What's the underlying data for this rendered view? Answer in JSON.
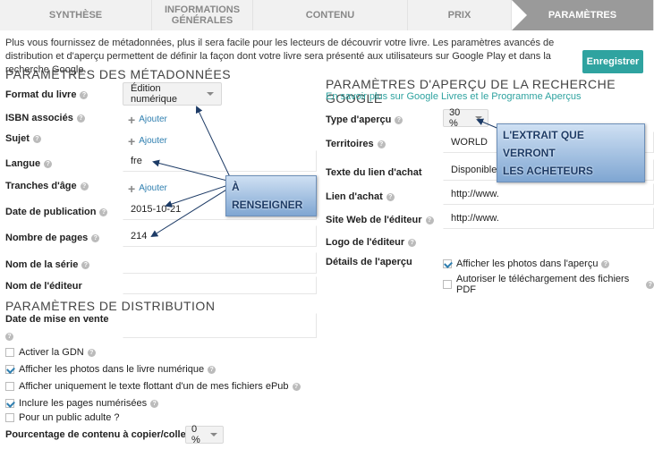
{
  "tabs": [
    "SYNTHÈSE",
    "INFORMATIONS GÉNÉRALES",
    "CONTENU",
    "PRIX",
    "PARAMÈTRES"
  ],
  "intro": "Plus vous fournissez de métadonnées, plus il sera facile pour les lecteurs de découvrir votre livre. Les paramètres avancés de distribution et d'aperçu permettent de définir la façon dont votre livre sera présenté aux utilisateurs sur Google Play et dans la recherche Google.",
  "save_label": "Enregistrer",
  "metadata": {
    "title": "PARAMÈTRES DES MÉTADONNÉES",
    "format_label": "Format du livre",
    "format_value": "Édition numérique",
    "isbn_label": "ISBN associés",
    "subject_label": "Sujet",
    "language_label": "Langue",
    "language_value": "fre",
    "age_label": "Tranches d'âge",
    "pubdate_label": "Date de publication",
    "pubdate_value": "2015-10-21",
    "pages_label": "Nombre de pages",
    "pages_value": "214",
    "series_label": "Nom de la série",
    "publisher_label": "Nom de l'éditeur",
    "add_label": "Ajouter"
  },
  "distribution": {
    "title": "PARAMÈTRES DE DISTRIBUTION",
    "sale_date_label": "Date de mise en vente",
    "options": [
      {
        "label": "Activer la GDN",
        "checked": false
      },
      {
        "label": "Afficher les photos dans le livre numérique",
        "checked": true
      },
      {
        "label": "Afficher uniquement le texte flottant d'un de mes fichiers ePub",
        "checked": false
      },
      {
        "label": "Inclure les pages numérisées",
        "checked": true
      },
      {
        "label": "Pour un public adulte ?",
        "checked": false
      }
    ],
    "copy_label": "Pourcentage de contenu à copier/coller",
    "copy_value": "0 %"
  },
  "preview": {
    "title": "PARAMÈTRES D'APERÇU DE LA RECHERCHE GOOGLE",
    "link": "En savoir plus sur Google Livres et le Programme Aperçus",
    "type_label": "Type d'aperçu",
    "type_value": "30 %",
    "territories_label": "Territoires",
    "territories_value": "WORLD",
    "buy_text_label": "Texte du lien d'achat",
    "buy_text_value": "Disponible chez",
    "buy_link_label": "Lien d'achat",
    "buy_link_value": "http://www.",
    "publisher_site_label": "Site Web de l'éditeur",
    "publisher_site_value": "http://www.",
    "logo_label": "Logo de l'éditeur",
    "details_label": "Détails de l'aperçu",
    "details_options": [
      {
        "label": "Afficher les photos dans l'aperçu",
        "checked": true
      },
      {
        "label": "Autoriser le téléchargement des fichiers PDF",
        "checked": false
      }
    ]
  },
  "callouts": {
    "fill": "À RENSEIGNER",
    "extract_line1": "L'EXTRAIT QUE VERRONT",
    "extract_line2": "LES ACHETEURS"
  },
  "colors": {
    "accent": "#2fa3a0",
    "link": "#2f7fb0",
    "callout": "#7fa6d2"
  }
}
